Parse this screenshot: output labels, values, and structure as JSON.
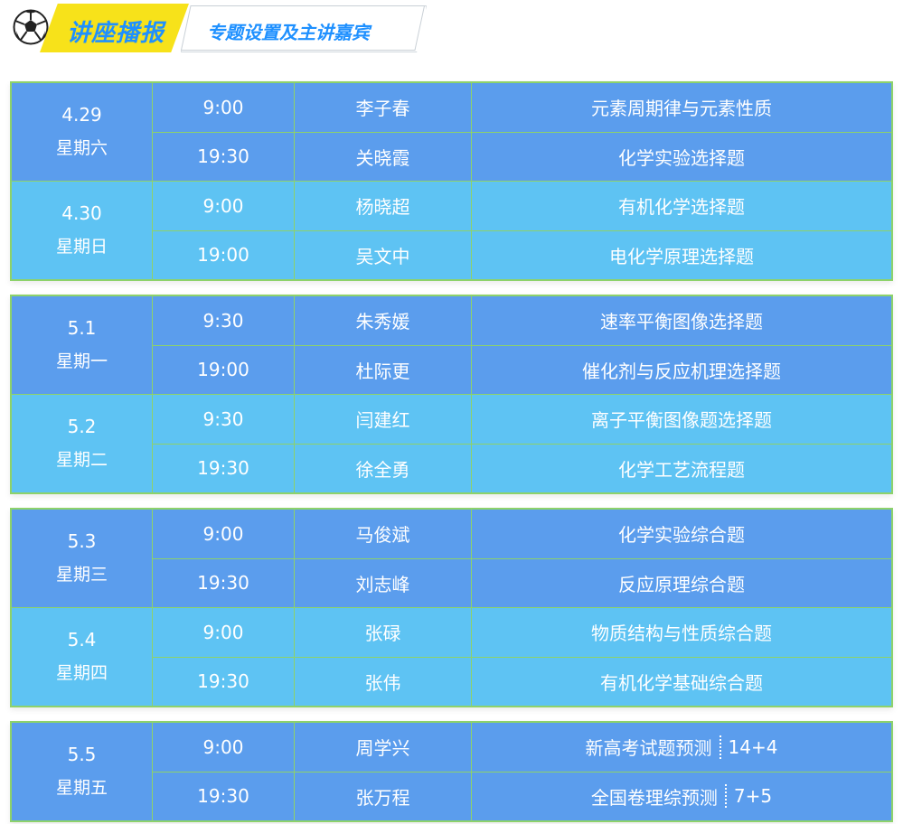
{
  "header": {
    "tag_primary": "讲座播报",
    "tag_secondary": "专题设置及主讲嘉宾"
  },
  "colors": {
    "row_dark": "#5b9ded",
    "row_light": "#5ec3f3",
    "border": "#8dd26a",
    "tag_yellow": "#f7e21a",
    "tag_text": "#1e90ff"
  },
  "groups": [
    {
      "days": [
        {
          "date": "4.29",
          "weekday": "星期六",
          "sessions": [
            {
              "time": "9:00",
              "speaker": "李子春",
              "topic": "元素周期律与元素性质"
            },
            {
              "time": "19:30",
              "speaker": "关晓霞",
              "topic": "化学实验选择题"
            }
          ]
        },
        {
          "date": "4.30",
          "weekday": "星期日",
          "sessions": [
            {
              "time": "9:00",
              "speaker": "杨晓超",
              "topic": "有机化学选择题"
            },
            {
              "time": "19:00",
              "speaker": "吴文中",
              "topic": "电化学原理选择题"
            }
          ]
        }
      ]
    },
    {
      "days": [
        {
          "date": "5.1",
          "weekday": "星期一",
          "sessions": [
            {
              "time": "9:30",
              "speaker": "朱秀媛",
              "topic": "速率平衡图像选择题"
            },
            {
              "time": "19:00",
              "speaker": "杜际更",
              "topic": "催化剂与反应机理选择题"
            }
          ]
        },
        {
          "date": "5.2",
          "weekday": "星期二",
          "sessions": [
            {
              "time": "9:30",
              "speaker": "闫建红",
              "topic": "离子平衡图像题选择题"
            },
            {
              "time": "19:30",
              "speaker": "徐全勇",
              "topic": "化学工艺流程题"
            }
          ]
        }
      ]
    },
    {
      "days": [
        {
          "date": "5.3",
          "weekday": "星期三",
          "sessions": [
            {
              "time": "9:00",
              "speaker": "马俊斌",
              "topic": "化学实验综合题"
            },
            {
              "time": "19:30",
              "speaker": "刘志峰",
              "topic": "反应原理综合题"
            }
          ]
        },
        {
          "date": "5.4",
          "weekday": "星期四",
          "sessions": [
            {
              "time": "9:00",
              "speaker": "张碌",
              "topic": "物质结构与性质综合题"
            },
            {
              "time": "19:30",
              "speaker": "张伟",
              "topic": "有机化学基础综合题"
            }
          ]
        }
      ]
    },
    {
      "days": [
        {
          "date": "5.5",
          "weekday": "星期五",
          "sessions": [
            {
              "time": "9:00",
              "speaker": "周学兴",
              "topic": "新高考试题预测",
              "suffix": "14+4"
            },
            {
              "time": "19:30",
              "speaker": "张万程",
              "topic": "全国卷理综预测",
              "suffix": "7+5"
            }
          ]
        }
      ]
    }
  ]
}
